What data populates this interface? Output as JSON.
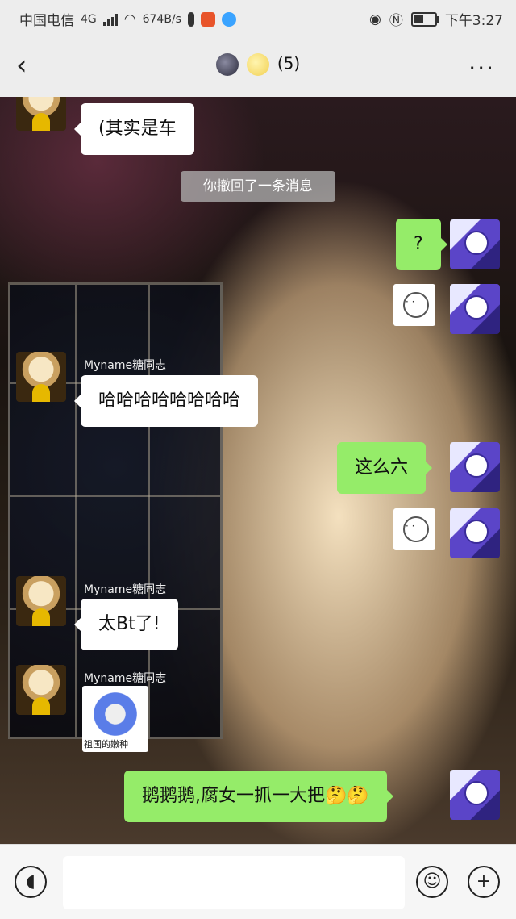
{
  "status_bar": {
    "carrier": "中国电信",
    "network": "4G",
    "speed": "674B/s",
    "time": "下午3:27",
    "battery_level": 0.45
  },
  "header": {
    "title": "(5)",
    "back_icon": "chevron-left-icon",
    "more_icon": "more-dots-icon"
  },
  "chat": {
    "system_notice": "你撤回了一条消息",
    "messages": [
      {
        "side": "left",
        "text": "(其实是车"
      },
      {
        "side": "right",
        "text": "?"
      },
      {
        "side": "right",
        "sticker": "bear-sticker"
      },
      {
        "side": "left",
        "nick": "Myname糖同志",
        "text": "哈哈哈哈哈哈哈哈"
      },
      {
        "side": "right",
        "text": "这么六"
      },
      {
        "side": "right",
        "sticker": "bear-sticker"
      },
      {
        "side": "left",
        "nick": "Myname糖同志",
        "text": "太Bt了!"
      },
      {
        "side": "left",
        "nick": "Myname糖同志",
        "sticker_caption": "祖国的嫩种"
      },
      {
        "side": "right",
        "text": "鹅鹅鹅,腐女一抓一大把🤔🤔"
      }
    ]
  },
  "input_bar": {
    "voice_icon": "voice-icon",
    "emoji_icon": "emoji-icon",
    "plus_icon": "plus-icon",
    "placeholder": ""
  },
  "colors": {
    "left_bubble": "#ffffff",
    "right_bubble": "#95ec69",
    "header_bg": "#ededed"
  }
}
